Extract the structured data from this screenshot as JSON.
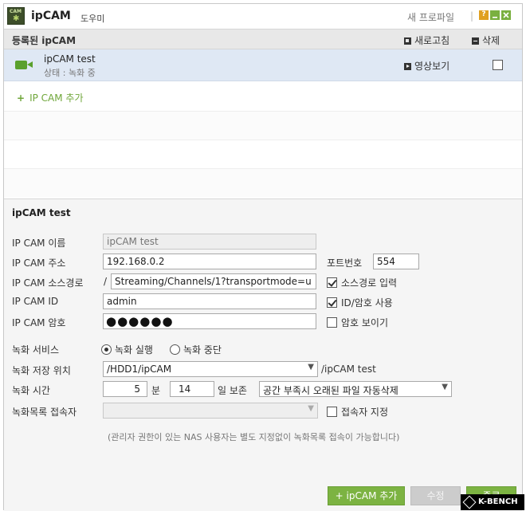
{
  "titlebar": {
    "app_title": "ipCAM",
    "app_subtitle": "도우미",
    "icon_label": "CAM",
    "new_profile": "새 프로파일",
    "separator": "|",
    "help_icon": "?"
  },
  "list": {
    "header_title": "등록된 ipCAM",
    "refresh_label": "새로고침",
    "delete_label": "삭제",
    "cameras": [
      {
        "name": "ipCAM test",
        "status": "상태 : 녹화 중",
        "view_label": "영상보기",
        "checked": false
      }
    ],
    "add_label": "IP CAM 추가",
    "add_plus": "+"
  },
  "detail": {
    "title": "ipCAM test",
    "name": {
      "label": "IP CAM 이름",
      "placeholder": "ipCAM test"
    },
    "address": {
      "label": "IP CAM 주소",
      "value": "192.168.0.2"
    },
    "port": {
      "label": "포트번호",
      "value": "554"
    },
    "source_path": {
      "label": "IP CAM 소스경로",
      "prefix": "/",
      "value": "Streaming/Channels/1?transportmode=u"
    },
    "source_input": {
      "label": "소스경로 입력",
      "checked": true
    },
    "cam_id": {
      "label": "IP CAM ID",
      "value": "admin"
    },
    "use_id_pw": {
      "label": "ID/암호 사용",
      "checked": true
    },
    "password": {
      "label": "IP CAM 암호",
      "dots": "●●●●●●"
    },
    "show_password": {
      "label": "암호 보이기",
      "checked": false
    },
    "rec_service": {
      "label": "녹화 서비스",
      "options": [
        "녹화 실행",
        "녹화 중단"
      ],
      "selected": 0
    },
    "save_location": {
      "label": "녹화 저장 위치",
      "value": "/HDD1/ipCAM",
      "suffix": "/ipCAM test"
    },
    "rec_time": {
      "label": "녹화 시간",
      "minutes": "5",
      "minutes_unit": "분",
      "days": "14",
      "days_unit": "일 보존",
      "policy": "공간 부족시 오래된 파일 자동삭제"
    },
    "rec_list_access": {
      "label": "녹화목록 접속자",
      "value": ""
    },
    "set_accessor": {
      "label": "접속자 지정",
      "checked": false
    },
    "note": "(관리자 권한이 있는 NAS 사용자는 별도 지정없이 녹화목록 접속이 가능합니다)"
  },
  "buttons": {
    "add": "+ ipCAM 추가",
    "edit": "수정",
    "close": "종료"
  },
  "watermark": "K-BENCH",
  "colors": {
    "accent_green": "#7cb342",
    "selected_row": "#dfe8f4",
    "camera_green": "#5aa02c"
  }
}
